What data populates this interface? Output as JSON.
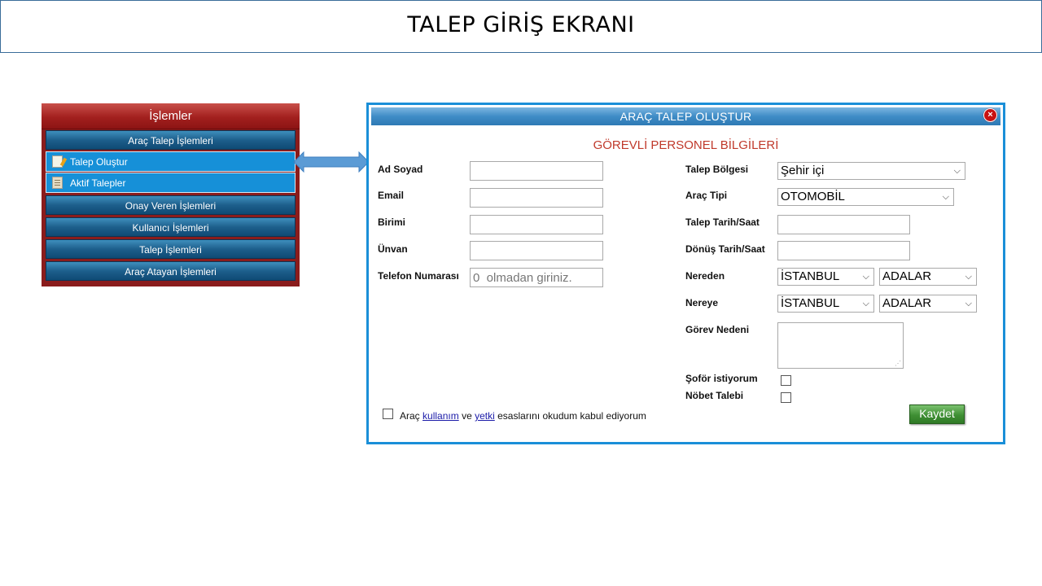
{
  "page": {
    "title": "TALEP GİRİŞ EKRANI"
  },
  "menu": {
    "header": "İşlemler",
    "groups": [
      "Araç Talep İşlemleri",
      "Onay Veren İşlemleri",
      "Kullanıcı İşlemleri",
      "Talep İşlemleri",
      "Araç Atayan İşlemleri"
    ],
    "items": [
      {
        "label": "Talep Oluştur",
        "icon": "edit-document-icon"
      },
      {
        "label": "Aktif Talepler",
        "icon": "calculator-icon"
      }
    ]
  },
  "dialog": {
    "title": "ARAÇ TALEP OLUŞTUR",
    "section_title": "GÖREVLİ PERSONEL BİLGİLERİ",
    "left_fields": {
      "ad_soyad": {
        "label": "Ad Soyad",
        "value": ""
      },
      "email": {
        "label": "Email",
        "value": ""
      },
      "birimi": {
        "label": "Birimi",
        "value": ""
      },
      "unvan": {
        "label": "Ünvan",
        "value": ""
      },
      "telefon": {
        "label": "Telefon Numarası",
        "value": "",
        "placeholder": "0  olmadan giriniz."
      }
    },
    "right_fields": {
      "talep_bolgesi": {
        "label": "Talep Bölgesi",
        "selected": "Şehir içi"
      },
      "arac_tipi": {
        "label": "Araç Tipi",
        "selected": "OTOMOBİL"
      },
      "talep_tarih": {
        "label": "Talep Tarih/Saat",
        "value": ""
      },
      "donus_tarih": {
        "label": "Dönüş Tarih/Saat",
        "value": ""
      },
      "nereden": {
        "label": "Nereden",
        "city": "İSTANBUL",
        "district": "ADALAR"
      },
      "nereye": {
        "label": "Nereye",
        "city": "İSTANBUL",
        "district": "ADALAR"
      },
      "gorev_nedeni": {
        "label": "Görev Nedeni",
        "value": ""
      },
      "sofor": {
        "label": "Şoför istiyorum",
        "checked": false
      },
      "nobet": {
        "label": "Nöbet Talebi",
        "checked": false
      }
    },
    "agreement": {
      "prefix": "Araç",
      "link1": "kullanım",
      "middle": "ve",
      "link2": "yetki",
      "suffix": "esaslarını okudum kabul ediyorum",
      "checked": false
    },
    "save_label": "Kaydet",
    "close_label": "×"
  },
  "colors": {
    "menu_header": "#a3201e",
    "menu_group": "#1d5f8c",
    "menu_item": "#1690d8",
    "dialog_border": "#1a8fd8",
    "section_title": "#c0392b",
    "save_button": "#3f8f34"
  }
}
